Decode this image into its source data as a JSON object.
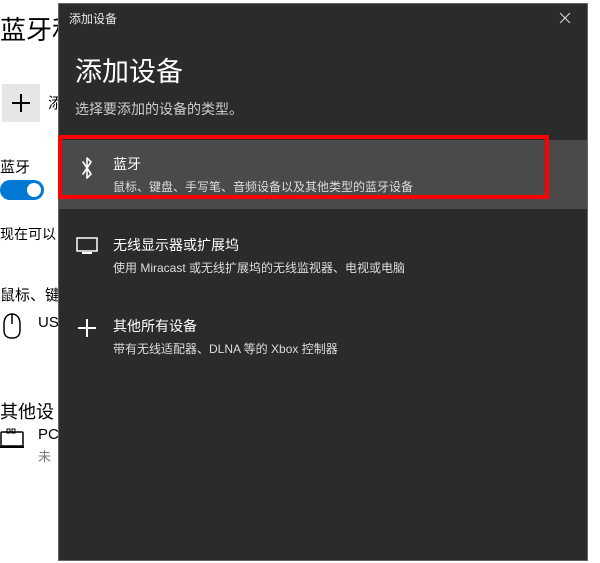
{
  "bg": {
    "heading": "蓝牙和",
    "add_label": "添",
    "bt_subhead": "蓝牙",
    "discover": "现在可以",
    "mouse_subhead": "鼠标、键",
    "usb_label": "US",
    "other_subhead": "其他设",
    "pc_label": "PC",
    "pc_status": "未"
  },
  "dialog": {
    "titlebar_title": "添加设备",
    "heading": "添加设备",
    "subtext": "选择要添加的设备的类型。",
    "options": [
      {
        "name": "bluetooth",
        "title": "蓝牙",
        "desc": "鼠标、键盘、手写笔、音频设备以及其他类型的蓝牙设备"
      },
      {
        "name": "wireless-display",
        "title": "无线显示器或扩展坞",
        "desc": "使用 Miracast 或无线扩展坞的无线监视器、电视或电脑"
      },
      {
        "name": "other",
        "title": "其他所有设备",
        "desc": "带有无线适配器、DLNA 等的 Xbox 控制器"
      }
    ]
  }
}
